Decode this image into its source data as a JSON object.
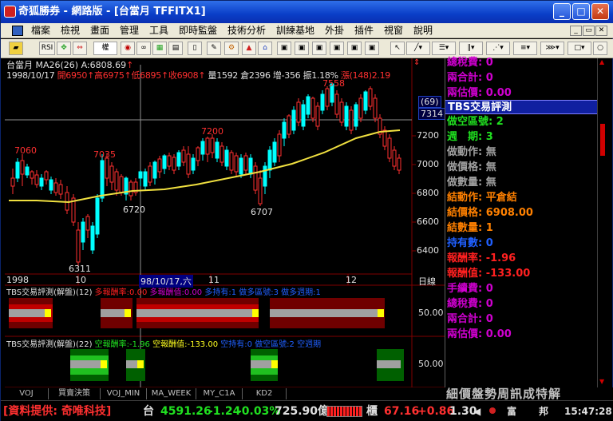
{
  "window": {
    "title": "奇狐勝券 - 網路版 - [台當月 TFFITX1]",
    "minimize_glyph": "_",
    "maximize_glyph": "□",
    "close_glyph": "✕"
  },
  "menu": {
    "items": [
      "檔案",
      "檢視",
      "畫面",
      "管理",
      "工具",
      "即時監盤",
      "技術分析",
      "訓練基地",
      "外掛",
      "插件",
      "視窗",
      "說明"
    ],
    "mdi": [
      "_",
      "▭",
      "✕"
    ]
  },
  "toolbar": {
    "rsi_label": "RSI",
    "combo_label": "權"
  },
  "chart": {
    "header": {
      "symbol": "台當月",
      "ma_label": "MA26(26)",
      "ma_value": "A:6808.69",
      "date": "1998/10/17",
      "open": "開6950",
      "high": "高6975",
      "low": "低6895",
      "close": "收6908",
      "volume": "量1592",
      "oi": "倉2396",
      "oi_change": "增-356",
      "amplitude": "振1.18%",
      "change": "漲(148)2.19"
    },
    "price_labels": {
      "p7060": "7060",
      "p7035": "7035",
      "p6720": "6720",
      "p6311": "6311",
      "p7200": "7200",
      "p6707": "6707",
      "p7558": "7558"
    },
    "axis_labels": {
      "a7200": "7200",
      "a7000": "7000",
      "a6800": "6800",
      "a6600": "6600",
      "a6400": "6400",
      "tag_top": "(69)",
      "tag_bottom": "7314"
    },
    "x_labels": {
      "year": "1998",
      "m10": "10",
      "cursor_date": "98/10/17,六",
      "m11": "11",
      "m12": "12",
      "period": "日線"
    },
    "pane1": {
      "title": "TBS交易評測(解盤)(12)",
      "field1": "多報酬率:0.00",
      "field2": "多報酬值:0.00",
      "field3": "多持有:1",
      "field4": "做多區號:3",
      "field5": "做多週期:1",
      "axis": "50.00"
    },
    "pane2": {
      "title": "TBS交易評測(解盤)(22)",
      "field1": "空報酬率:-1.96",
      "field2": "空報酬值:-133.00",
      "field3": "空持有:0",
      "field4": "做空區號:2",
      "field5": "空週期",
      "axis": "50.00"
    }
  },
  "right_panel": {
    "lines_top": [
      {
        "label": "總稅費:",
        "value": "0",
        "color": "#d000d0"
      },
      {
        "label": "兩合計:",
        "value": "0",
        "color": "#d000d0"
      },
      {
        "label": "兩估價:",
        "value": "0.00",
        "color": "#d000d0"
      }
    ],
    "section_title": "TBS交易評測",
    "lines": [
      {
        "label": "做空區號:",
        "value": "2",
        "color": "#20e020"
      },
      {
        "label": "週　期:",
        "value": "3",
        "color": "#20e020"
      },
      {
        "label": "做動作:",
        "value": "無",
        "color": "#a0a0a0"
      },
      {
        "label": "做價格:",
        "value": "無",
        "color": "#a0a0a0"
      },
      {
        "label": "做數量:",
        "value": "無",
        "color": "#a0a0a0"
      },
      {
        "label": "結動作:",
        "value": "平倉結",
        "color": "#ff8000"
      },
      {
        "label": "結價格:",
        "value": "6908.00",
        "color": "#ff8000"
      },
      {
        "label": "結數量:",
        "value": "1",
        "color": "#ff8000"
      },
      {
        "label": "持有數:",
        "value": "0",
        "color": "#2060ff"
      },
      {
        "label": "報酬率:",
        "value": "-1.96",
        "color": "#ff2020"
      },
      {
        "label": "報酬值:",
        "value": "-133.00",
        "color": "#ff2020"
      },
      {
        "label": "手續費:",
        "value": "0",
        "color": "#d000d0"
      },
      {
        "label": "總稅費:",
        "value": "0",
        "color": "#d000d0"
      },
      {
        "label": "兩合計:",
        "value": "0",
        "color": "#d000d0"
      },
      {
        "label": "兩估價:",
        "value": "0.00",
        "color": "#d000d0"
      }
    ]
  },
  "bottom_tabs": [
    "VOJ",
    "買賣決策",
    "VOJ_MIN",
    "MA_WEEK",
    "MY_C1A",
    "KD2"
  ],
  "bottom_right": "細價盤勢周訊成特解",
  "status": {
    "provider": "[資料提供: 奇唯科技]",
    "idx_name": "台",
    "idx_value": "4591.26",
    "idx_change": "-1.24",
    "idx_pct": "-0.03%",
    "idx_amount": "725.90億",
    "fut_name": "櫃",
    "fut_value": "67.16",
    "fut_change": "+0.86",
    "fut_ratio": "1.30",
    "rich": "富",
    "state": "邦",
    "time": "15:47:28"
  }
}
